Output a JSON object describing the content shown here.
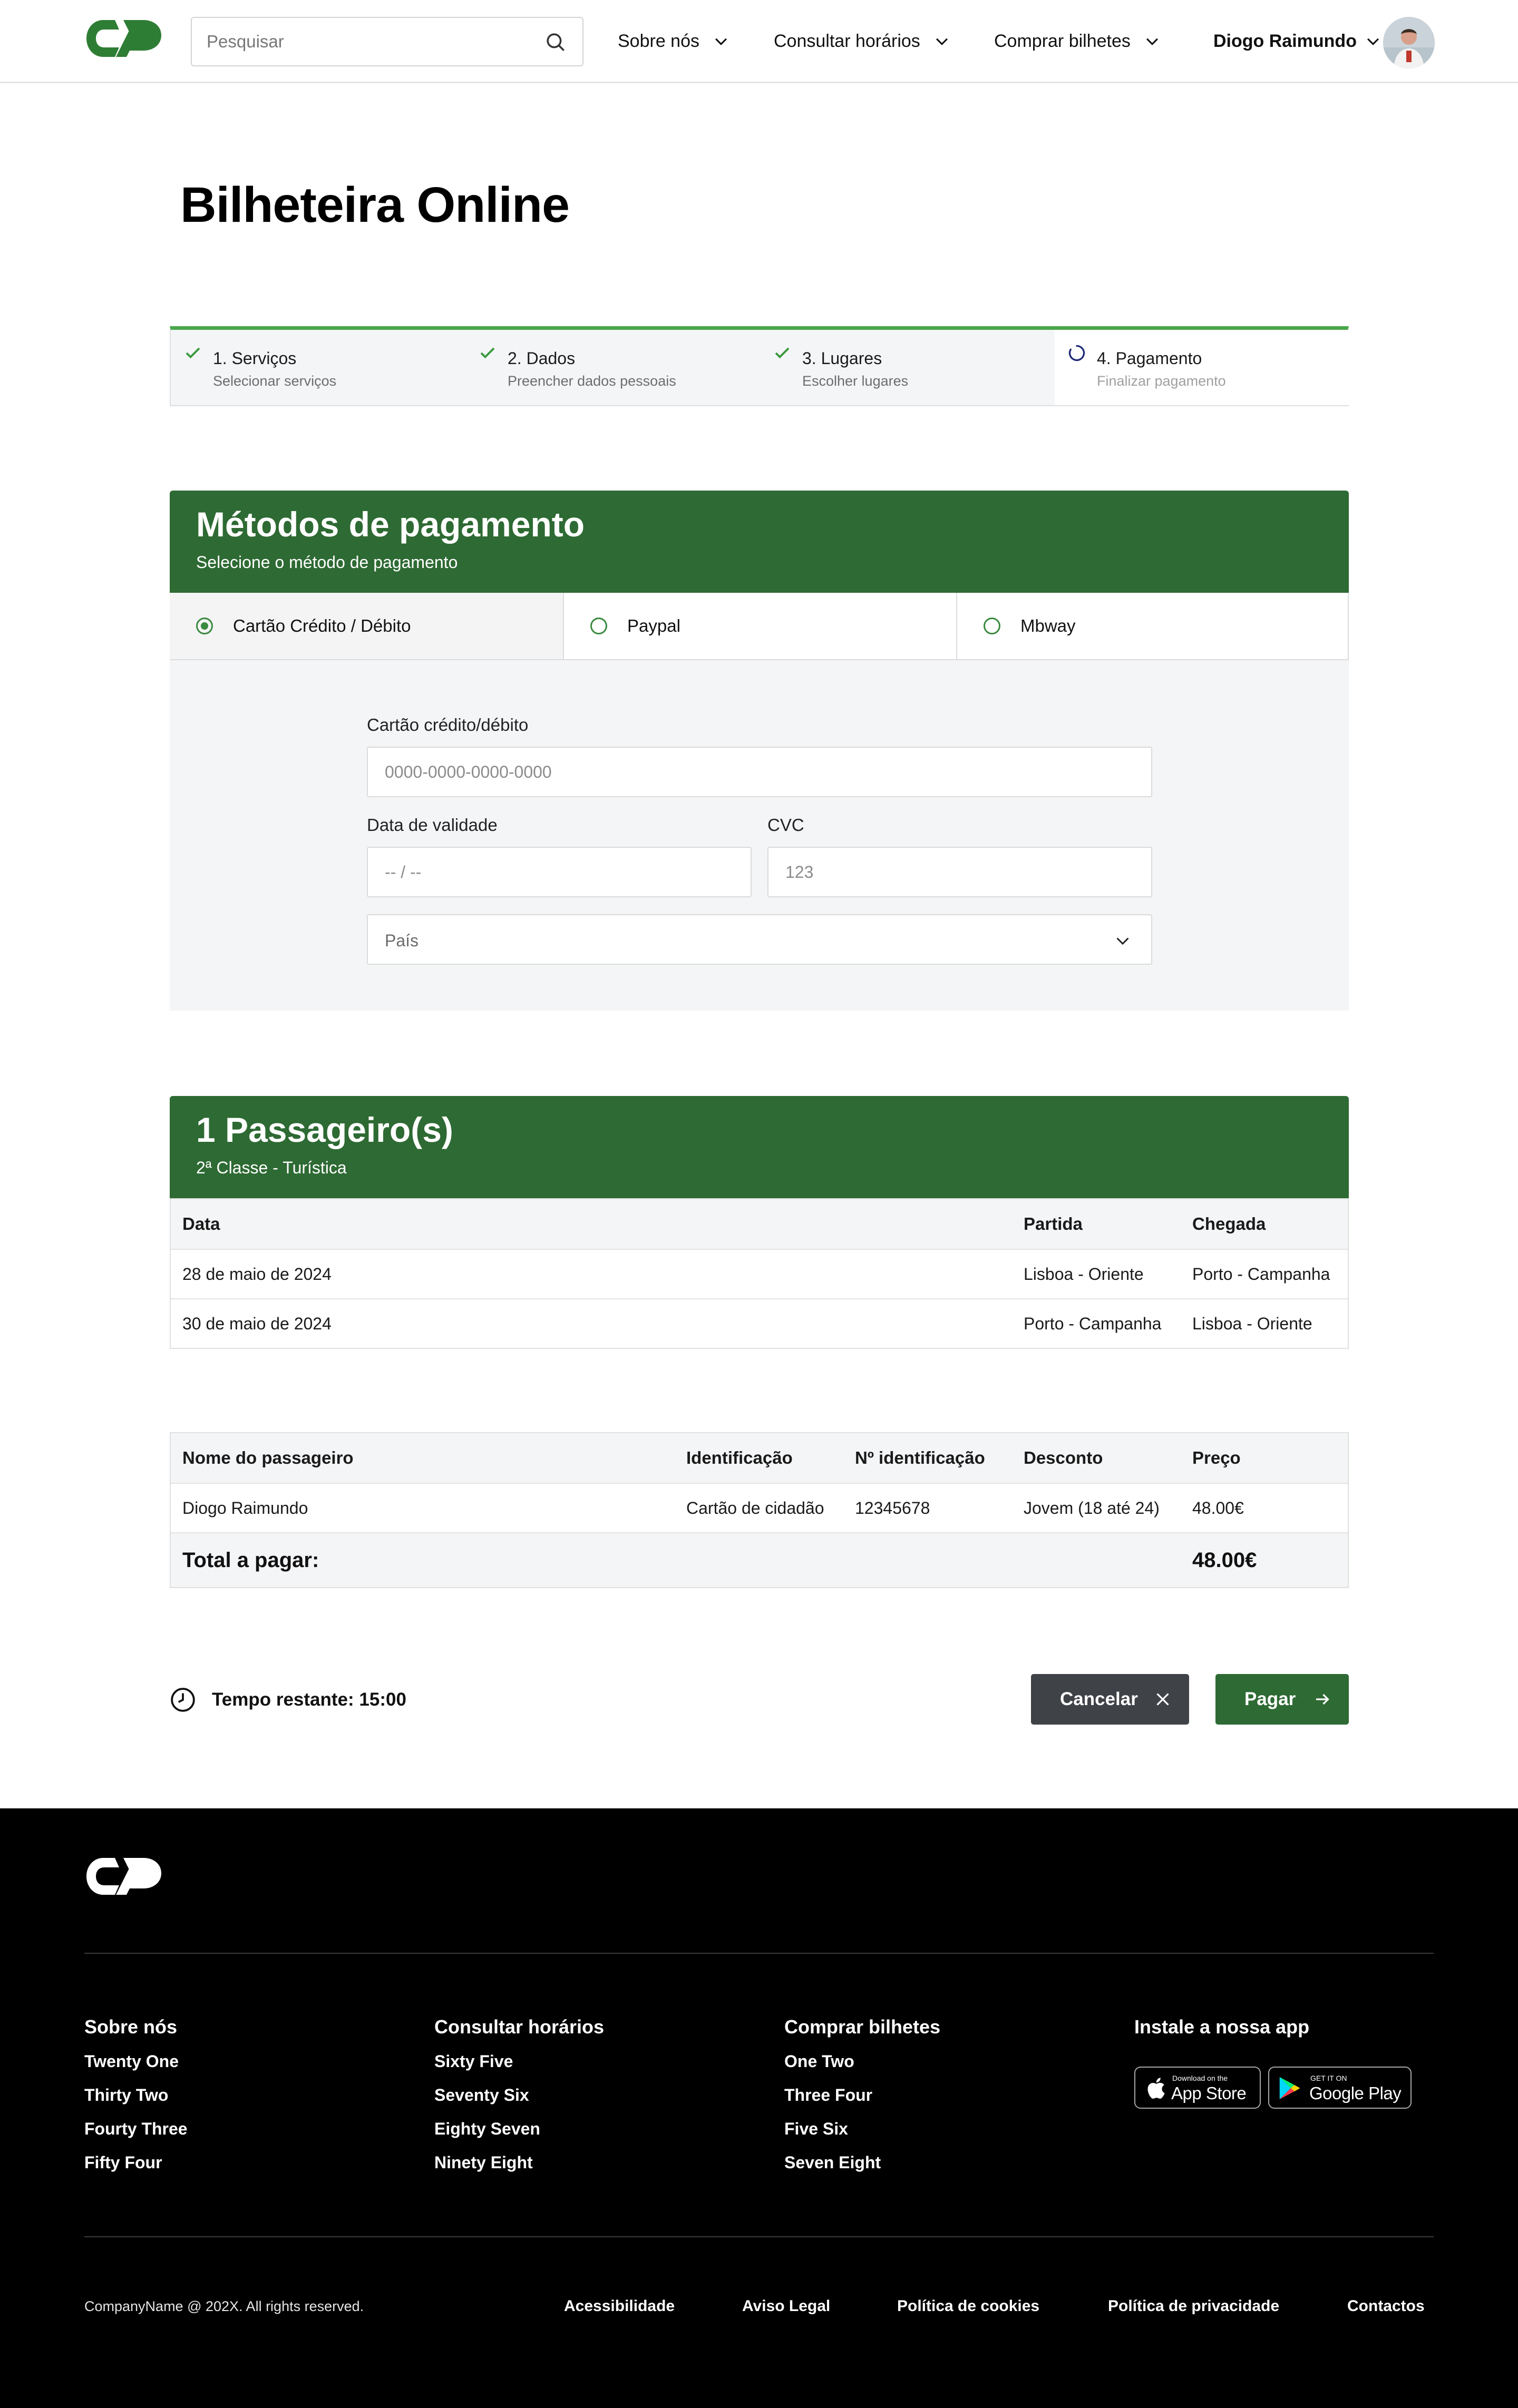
{
  "header": {
    "search_placeholder": "Pesquisar",
    "nav": [
      "Sobre nós",
      "Consultar horários",
      "Comprar bilhetes"
    ],
    "user_name": "Diogo Raimundo"
  },
  "page_title": "Bilheteira Online",
  "stepper": [
    {
      "title": "1. Serviços",
      "subtitle": "Selecionar serviços",
      "status": "done"
    },
    {
      "title": "2. Dados",
      "subtitle": "Preencher dados pessoais",
      "status": "done"
    },
    {
      "title": "3. Lugares",
      "subtitle": "Escolher lugares",
      "status": "done"
    },
    {
      "title": "4. Pagamento",
      "subtitle": "Finalizar pagamento",
      "status": "in-progress"
    }
  ],
  "payment": {
    "title": "Métodos de pagamento",
    "subtitle": "Selecione o método de pagamento",
    "methods": [
      "Cartão Crédito / Débito",
      "Paypal",
      "Mbway"
    ],
    "selected_method": "Cartão Crédito / Débito",
    "card_label": "Cartão crédito/débito",
    "card_placeholder": "0000-0000-0000-0000",
    "expiry_label": "Data de validade",
    "expiry_placeholder": "-- / --",
    "cvc_label": "CVC",
    "cvc_placeholder": "123",
    "country_placeholder": "País"
  },
  "passengers": {
    "title": "1 Passageiro(s)",
    "subtitle": "2ª Classe - Turística",
    "columns": [
      "Data",
      "Partida",
      "Chegada"
    ],
    "rows": [
      [
        "28 de maio de 2024",
        "Lisboa - Oriente",
        "Porto - Campanha"
      ],
      [
        "30 de maio de 2024",
        "Porto - Campanha",
        "Lisboa - Oriente"
      ]
    ]
  },
  "summary": {
    "columns": [
      "Nome do passageiro",
      "Identificação",
      "Nº identificação",
      "Desconto",
      "Preço"
    ],
    "rows": [
      [
        "Diogo Raimundo",
        "Cartão de cidadão",
        "12345678",
        "Jovem (18 até 24)",
        "48.00€"
      ]
    ],
    "total_label": "Total a pagar:",
    "total_value": "48.00€"
  },
  "actions": {
    "timer": "Tempo restante: 15:00",
    "cancel": "Cancelar",
    "pay": "Pagar"
  },
  "colors": {
    "brand_green": "#2e6a33",
    "stepper_accent": "#4aa64a",
    "cancel_gray": "#3f4246"
  },
  "footer": {
    "columns": [
      {
        "title": "Sobre nós",
        "links": [
          "Twenty One",
          "Thirty Two",
          "Fourty Three",
          "Fifty Four"
        ]
      },
      {
        "title": "Consultar horários",
        "links": [
          "Sixty Five",
          "Seventy Six",
          "Eighty Seven",
          "Ninety Eight"
        ]
      },
      {
        "title": "Comprar bilhetes",
        "links": [
          "One Two",
          "Three Four",
          "Five Six",
          "Seven Eight"
        ]
      }
    ],
    "app_title": "Instale a nossa app",
    "app_store_small": "Download on the",
    "app_store_big": "App Store",
    "google_play_small": "GET IT ON",
    "google_play_big": "Google Play",
    "copyright": "CompanyName @ 202X. All rights reserved.",
    "legal": [
      "Acessibilidade",
      "Aviso Legal",
      "Política de cookies",
      "Política de privacidade",
      "Contactos"
    ]
  }
}
